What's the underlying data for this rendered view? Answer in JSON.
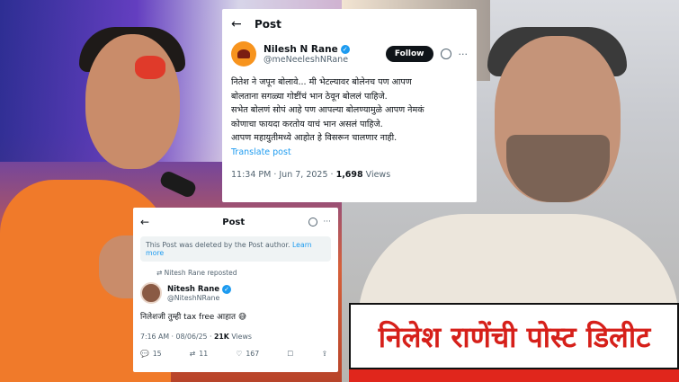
{
  "colors": {
    "headline_red": "#d6201a",
    "link_blue": "#1d9bf0",
    "verified_blue": "#1d9bf0",
    "text_dark": "#0f1419",
    "text_muted": "#536471"
  },
  "top_post": {
    "header_title": "Post",
    "back_icon": "arrow-left-icon",
    "author_name": "Nilesh N Rane",
    "author_handle": "@meNeeleshNRane",
    "follow_label": "Follow",
    "lines": [
      "नितेश ने जपून बोलावे... मी भेटल्यावर बोलेनच पण आपण",
      "बोलताना सगळ्या गोष्टींचं भान ठेवून बोललं पाहिजे.",
      "सभेत बोलणं सोपं आहे पण आपल्या बोलण्यामुळे आपण नेमकं",
      "कोणाचा फायदा करतोय याचं भान असलं पाहिजे.",
      "आपण महायुतीमध्ये आहोत हे विसरून चालणार नाही."
    ],
    "translate_label": "Translate post",
    "timestamp": "11:34 PM · Jun 7, 2025 · ",
    "views_count": "1,698",
    "views_label": " Views"
  },
  "bottom_post": {
    "header_title": "Post",
    "deleted_notice": "This Post was deleted by the Post author. ",
    "learn_more": "Learn more",
    "repost_label": "Nitesh Rane reposted",
    "author_name": "Nitesh Rane",
    "author_handle": "@NiteshNRane",
    "body": "निलेशजी तुम्ही tax free आहात 😅",
    "timestamp": "7:16 AM · 08/06/25 · ",
    "views_count": "21K",
    "views_label": " Views",
    "actions": {
      "replies": "15",
      "reposts": "11",
      "likes": "167"
    }
  },
  "headline": "निलेश राणेंची पोस्ट डिलीट"
}
